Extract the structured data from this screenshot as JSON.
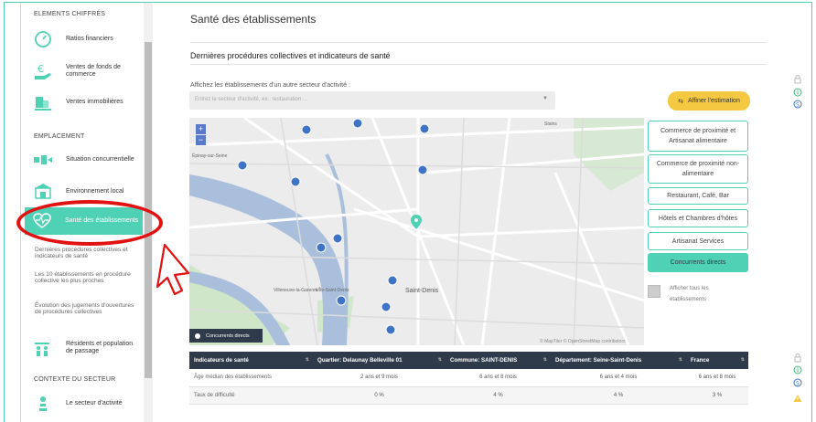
{
  "sidebar": {
    "sections": [
      "ELEMENTS CHIFFRÉS",
      "EMPLACEMENT",
      "CONTEXTE DU SECTEUR"
    ],
    "items": [
      {
        "label": "Ratios financiers",
        "icon": "gauge-icon"
      },
      {
        "label": "Ventes de fonds de commerce",
        "icon": "euro-hand-icon"
      },
      {
        "label": "Ventes immobilières",
        "icon": "building-sale-icon"
      },
      {
        "label": "Situation concurrentielle",
        "icon": "competition-icon"
      },
      {
        "label": "Environnement local",
        "icon": "local-shop-icon"
      },
      {
        "label": "Santé des établissements",
        "icon": "heartbeat-icon"
      },
      {
        "label": "Résidents et population de passage",
        "icon": "people-icon"
      },
      {
        "label": "Le secteur d'activité",
        "icon": "sector-icon"
      }
    ],
    "sub_links": [
      "Dernières procédures collectives et indicateurs de santé",
      "Les 10 établissements en procédure collective les plus proches",
      "Évolution des jugements d'ouvertures de procédures collectives"
    ]
  },
  "main": {
    "title": "Santé des établissements",
    "section_title": "Dernières procédures collectives et indicateurs de santé",
    "filter_label": "Affichez les établissements d'un autre secteur d'activité :",
    "select_placeholder": "Entrez le secteur d'activité, ex.: restauration ...",
    "affiner_label": "Affiner l'estimation"
  },
  "map": {
    "labels": {
      "saint_denis": "Saint-Denis",
      "villeneuve": "Villeneuve-la-Garenne",
      "stains": "Stains",
      "epinay": "Épinay-sur-Seine",
      "ile_st_denis": "L'Île-Saint-Denis"
    },
    "legend": "Concurrents directs",
    "attribution": "© MapTiler © OpenStreetMap contributors",
    "zoom_in": "+",
    "zoom_out": "−"
  },
  "categories": [
    "Commerce de proximité et Artisanat alimentaire",
    "Commerce de proximité non-alimentaire",
    "Restaurant, Café, Bar",
    "Hôtels et Chambres d'hôtes",
    "Artisanat Services",
    "Concurrents directs"
  ],
  "show_all_label": "Afficher tous les établissements",
  "table": {
    "headers": [
      "Indicateurs de santé",
      "Quartier: Delaunay Belleville 01",
      "Commune: SAINT-DENIS",
      "Département: Seine-Saint-Denis",
      "France"
    ],
    "rows": [
      [
        "Âge médian des établissements",
        "2 ans et 9 mois",
        "6 ans et 8 mois",
        "6 ans et 4 mois",
        "6 ans et 8 mois"
      ],
      [
        "Taux de difficulté",
        "0 %",
        "4 %",
        "4 %",
        "3 %"
      ]
    ]
  },
  "colors": {
    "accent": "#4fd1b5",
    "table_header": "#2f3b4a",
    "affiner": "#f5c842",
    "marker": "#3e73c6",
    "annotation": "#e11212"
  }
}
